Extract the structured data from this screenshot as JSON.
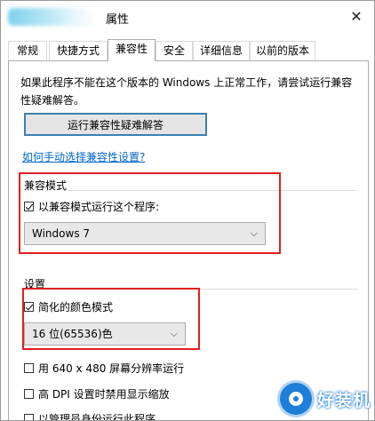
{
  "window": {
    "title": "属性"
  },
  "tabs": [
    {
      "label": "常规"
    },
    {
      "label": "快捷方式"
    },
    {
      "label": "兼容性",
      "active": true
    },
    {
      "label": "安全"
    },
    {
      "label": "详细信息"
    },
    {
      "label": "以前的版本"
    }
  ],
  "compat": {
    "description": "如果此程序不能在这个版本的 Windows 上正常工作，请尝试运行兼容性疑难解答。",
    "troubleshoot_button": "运行兼容性疑难解答",
    "manual_link": "如何手动选择兼容性设置?"
  },
  "compat_mode": {
    "group_label": "兼容模式",
    "checkbox_label": "以兼容模式运行这个程序:",
    "checked": true,
    "select_value": "Windows 7"
  },
  "settings": {
    "group_label": "设置",
    "reduced_color": {
      "label": "简化的颜色模式",
      "checked": true
    },
    "color_select_value": "16 位(65536)色",
    "run_640": {
      "label": "用 640 x 480 屏幕分辨率运行",
      "checked": false
    },
    "dpi": {
      "label": "高 DPI 设置时禁用显示缩放",
      "checked": false
    },
    "admin": {
      "label": "以管理员身份运行此程序",
      "checked": false
    }
  },
  "watermark": {
    "text": "好装机",
    "icon": "eye-logo-icon"
  },
  "colors": {
    "highlight_box": "#e02020",
    "link": "#0066cc",
    "button_border": "#3c7fb1"
  }
}
